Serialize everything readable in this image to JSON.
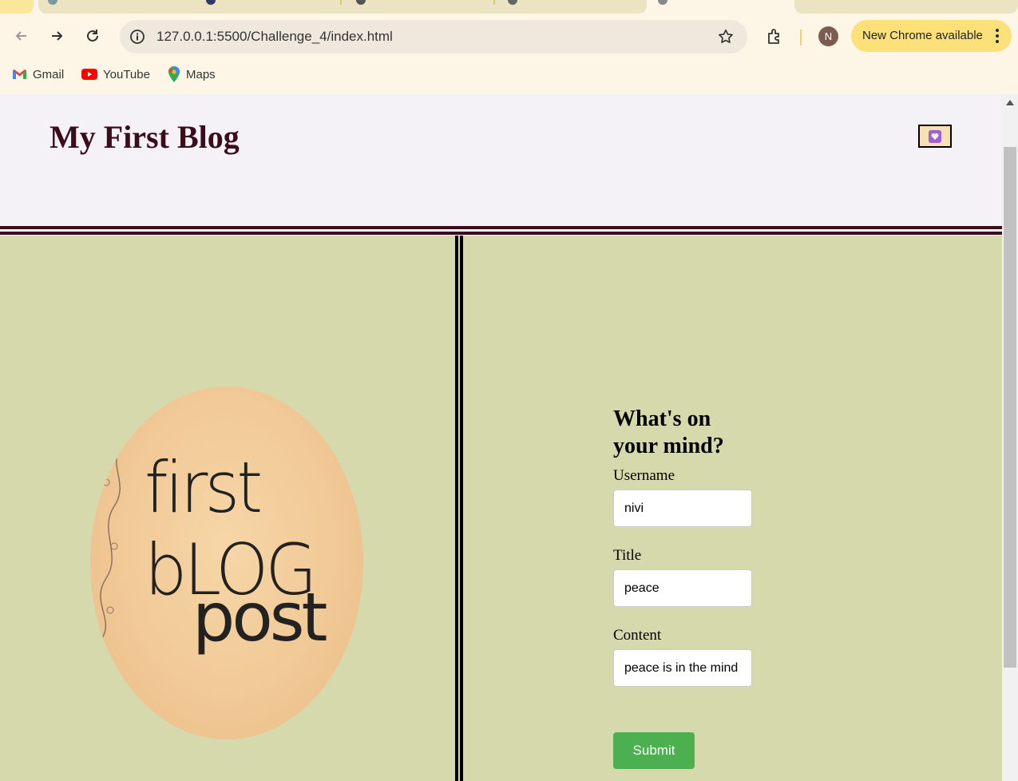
{
  "browser": {
    "url": "127.0.0.1:5500/Challenge_4/index.html",
    "profile_initial": "N",
    "update_label": "New Chrome available",
    "bookmarks": [
      {
        "label": "Gmail",
        "icon": "gmail-icon"
      },
      {
        "label": "YouTube",
        "icon": "youtube-icon"
      },
      {
        "label": "Maps",
        "icon": "maps-icon"
      }
    ]
  },
  "page": {
    "title": "My First Blog",
    "hero_image": {
      "line1": "first bLOG",
      "line2": "post"
    },
    "form": {
      "heading": "What's on your mind?",
      "username_label": "Username",
      "username_value": "nivi",
      "title_label": "Title",
      "title_value": "peace",
      "content_label": "Content",
      "content_value": "peace is in the mind",
      "submit_label": "Submit"
    }
  },
  "colors": {
    "title": "#3b0d1a",
    "content_bg": "#d6d9ac",
    "submit": "#4caf50",
    "update_chip": "#fce17a"
  }
}
